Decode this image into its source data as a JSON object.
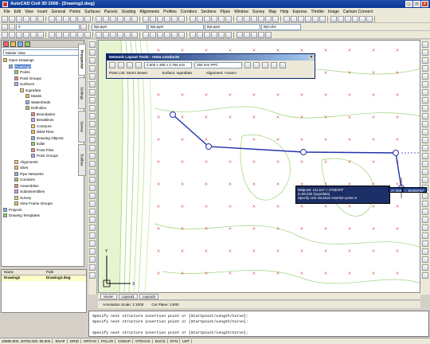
{
  "window": {
    "title": "AutoCAD Civil 3D 2008 - [Drawing2.dwg]"
  },
  "menu": [
    "File",
    "Edit",
    "View",
    "Insert",
    "General",
    "Points",
    "Surfaces",
    "Parcels",
    "Grading",
    "Alignments",
    "Profiles",
    "Corridors",
    "Sections",
    "Pipes",
    "Window",
    "Survey",
    "Map",
    "Help",
    "Express",
    "Trimble",
    "Image",
    "Carlson Connect"
  ],
  "toolbar": {
    "layer_combo": "0",
    "bylayer_1": "ByLayer",
    "bylayer_2": "ByLayer",
    "bylayer_3": "ByLayer",
    "bycolor": "ByColor"
  },
  "prospector": {
    "view": "Master View",
    "tabs": [
      "Prospector",
      "Settings",
      "Survey",
      "Toolbox"
    ],
    "tree": [
      {
        "label": "Open Drawings",
        "level": 0
      },
      {
        "label": "Drawing2",
        "level": 1,
        "bold": true
      },
      {
        "label": "Points",
        "level": 2
      },
      {
        "label": "Point Groups",
        "level": 2
      },
      {
        "label": "Surfaces",
        "level": 2
      },
      {
        "label": "suprafata",
        "level": 3
      },
      {
        "label": "Masks",
        "level": 4
      },
      {
        "label": "Watersheds",
        "level": 4
      },
      {
        "label": "Definition",
        "level": 4
      },
      {
        "label": "Boundaries",
        "level": 5
      },
      {
        "label": "Breaklines",
        "level": 5
      },
      {
        "label": "Contours",
        "level": 5
      },
      {
        "label": "DEM Files",
        "level": 5
      },
      {
        "label": "Drawing Objects",
        "level": 5
      },
      {
        "label": "Edits",
        "level": 5
      },
      {
        "label": "Point Files",
        "level": 5
      },
      {
        "label": "Point Groups",
        "level": 5
      },
      {
        "label": "Alignments",
        "level": 2
      },
      {
        "label": "Sites",
        "level": 2
      },
      {
        "label": "Pipe Networks",
        "level": 2
      },
      {
        "label": "Corridors",
        "level": 2
      },
      {
        "label": "Assemblies",
        "level": 2
      },
      {
        "label": "Subassemblies",
        "level": 2
      },
      {
        "label": "Survey",
        "level": 2
      },
      {
        "label": "View Frame Groups",
        "level": 2
      },
      {
        "label": "Projects",
        "level": 0
      },
      {
        "label": "Drawing Templates",
        "level": 0
      }
    ]
  },
  "bottom_panel": {
    "col_name": "Name",
    "col_path": "Path",
    "row_name": "Drawing2",
    "row_path": "Drawing2.dwg"
  },
  "network_tools": {
    "title": "Network Layout Tools - retea conducte",
    "structure": "2,600 x 305 x 2,794 mm",
    "pipe": "250 mm PPC",
    "parts_list": "Parts List: Storm Sewer",
    "surface": "Surface: suprafata",
    "alignment": "Alignment: <none>"
  },
  "tooltip": {
    "lines": [
      "Midpoint: 211.517 < 270d00'0\"",
      "Z=90.033 (suprafata)",
      "Specify next structure insertion point or"
    ],
    "coord_1": "27.058",
    "coord_2": "< 282d50'52\""
  },
  "layout_tabs": [
    "Model",
    "Layout1",
    "Layout2"
  ],
  "annotation": {
    "scale": "Annotation Scale: 1:1000",
    "cut": "Cut Plane: 3.500"
  },
  "command_lines": [
    "Specify next structure insertion point or [Startpoint/Length/Curve]:",
    "Specify next structure insertion point or [Startpoint/Length/Curve]:",
    "",
    "Specify next structure insertion point or [Startpoint/Length/Curve]:"
  ],
  "statusbar": {
    "coords": "20880.900, 20750.028, 95.000",
    "items": [
      "SNAP",
      "GRID",
      "ORTHO",
      "POLAR",
      "OSNAP",
      "OTRACK",
      "DUCS",
      "DYN",
      "LWT"
    ]
  },
  "colors": {
    "title_blue": "#0a3596",
    "contour": "#9fd27a",
    "pipe": "#2233aa",
    "grid_cross": "#cc2222"
  }
}
